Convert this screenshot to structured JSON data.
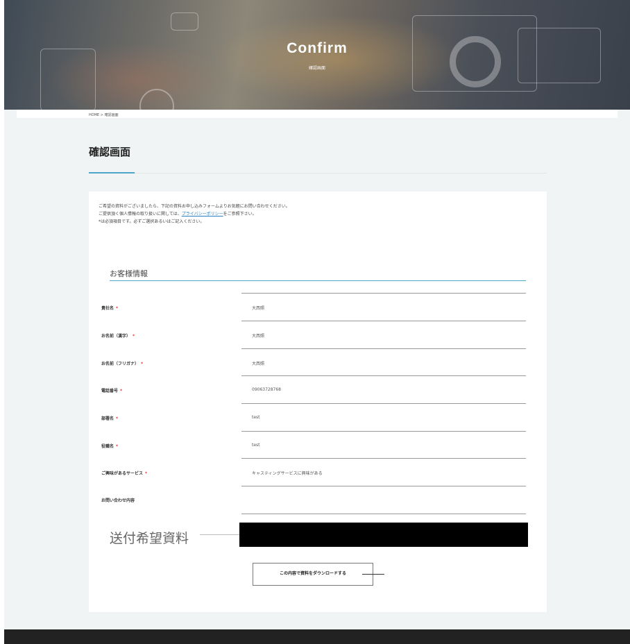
{
  "hero": {
    "title": "Confirm",
    "subtitle": "確認画面"
  },
  "breadcrumb": {
    "home": "HOME",
    "separator": ">",
    "current": "確認画面"
  },
  "page_title": "確認画面",
  "intro": {
    "line1": "ご希望の資料がございましたら、下記の資料お申し込みフォームよりお気軽にお問い合わせください。",
    "line2_before": "ご提供頂く個人情報の取り扱いに関しては、",
    "line2_link": "プライバシーポリシー",
    "line2_after": "をご参照下さい。",
    "line3": "*は必須項目です。必ずご選択あるいはご記入ください。"
  },
  "section_title": "お客様情報",
  "required_mark": "*",
  "fields": [
    {
      "label": "貴社名",
      "required": true,
      "value": "大西照"
    },
    {
      "label": "お名前（漢字）",
      "required": true,
      "value": "大西照"
    },
    {
      "label": "お名前（フリガナ）",
      "required": true,
      "value": "大西照"
    },
    {
      "label": "電話番号",
      "required": true,
      "value": "09063728768"
    },
    {
      "label": "部署名",
      "required": true,
      "value": "test"
    },
    {
      "label": "役職名",
      "required": true,
      "value": "test"
    },
    {
      "label": "ご興味があるサービス",
      "required": true,
      "value": "キャスティングサービスに興味がある"
    },
    {
      "label": "お問い合わせ内容",
      "required": false,
      "value": ""
    }
  ],
  "docs_title": "送付希望資料",
  "download_button": "この内容で資料をダウンロードする",
  "colors": {
    "accent": "#4aa5c9",
    "required": "#e03a3a",
    "footer": "#222222",
    "background": "#f1f4f4"
  }
}
